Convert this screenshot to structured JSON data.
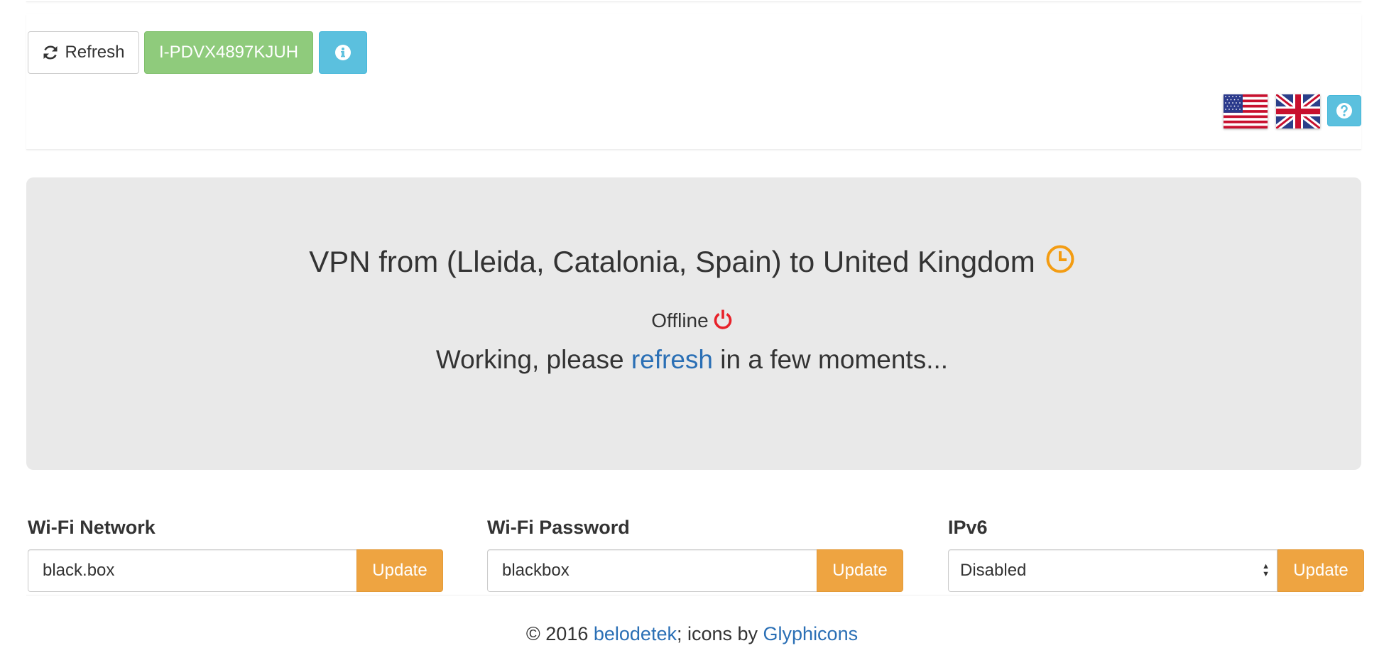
{
  "toolbar": {
    "refresh_label": "Refresh",
    "device_id": "I-PDVX4897KJUH"
  },
  "languages": [
    "en-US",
    "en-GB"
  ],
  "status": {
    "vpn_title": "VPN from (Lleida, Catalonia, Spain) to United Kingdom",
    "state": "Offline",
    "working_prefix": "Working, please ",
    "working_link": "refresh",
    "working_suffix": " in a few moments..."
  },
  "form": {
    "wifi_network": {
      "label": "Wi-Fi Network",
      "value": "black.box",
      "button": "Update"
    },
    "wifi_password": {
      "label": "Wi-Fi Password",
      "value": "blackbox",
      "button": "Update"
    },
    "ipv6": {
      "label": "IPv6",
      "selected": "Disabled",
      "button": "Update"
    }
  },
  "footer": {
    "prefix": "© 2016 ",
    "author": "belodetek",
    "middle": "; icons by ",
    "icons_link": "Glyphicons"
  },
  "colors": {
    "success": "#8fcb7c",
    "info": "#5bc0de",
    "warning": "#eea441",
    "danger": "#e8222a",
    "link": "#2a6fb5",
    "clock": "#f39c12"
  }
}
